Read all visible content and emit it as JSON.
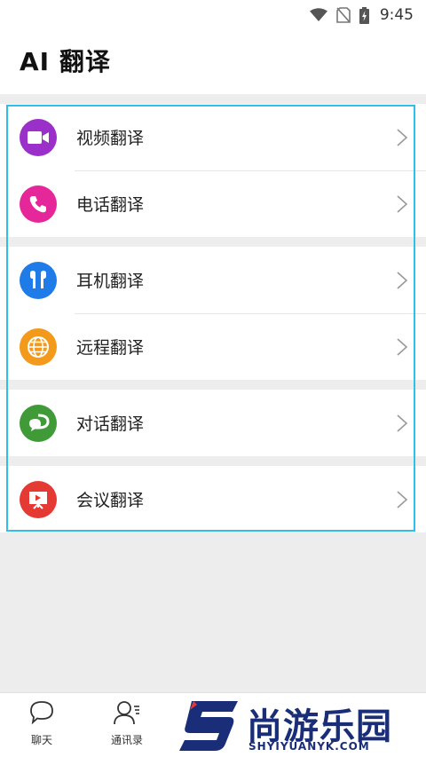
{
  "status_bar": {
    "time": "9:45",
    "icons": [
      "wifi-icon",
      "no-sim-icon",
      "battery-charging-icon"
    ]
  },
  "header": {
    "title": "AI 翻译"
  },
  "menu": {
    "groups": [
      {
        "items": [
          {
            "label": "视频翻译",
            "icon": "video-camera-icon",
            "color": "#9b2fc9"
          },
          {
            "label": "电话翻译",
            "icon": "phone-icon",
            "color": "#e6279a"
          }
        ]
      },
      {
        "items": [
          {
            "label": "耳机翻译",
            "icon": "earbuds-icon",
            "color": "#1f7be8"
          },
          {
            "label": "远程翻译",
            "icon": "globe-icon",
            "color": "#f39a1c"
          }
        ]
      },
      {
        "items": [
          {
            "label": "对话翻译",
            "icon": "chat-bubbles-icon",
            "color": "#3f9a37"
          }
        ]
      },
      {
        "items": [
          {
            "label": "会议翻译",
            "icon": "presentation-icon",
            "color": "#e53a33"
          }
        ]
      }
    ]
  },
  "highlight_color": "#2fc0ea",
  "bottom_nav": {
    "items": [
      {
        "label": "聊天",
        "icon": "chat-icon"
      },
      {
        "label": "通讯录",
        "icon": "contacts-icon"
      }
    ]
  },
  "watermark": {
    "title": "尚游乐园",
    "subtitle": "SHYIYUANYK.COM",
    "color": "#1a2d78"
  }
}
